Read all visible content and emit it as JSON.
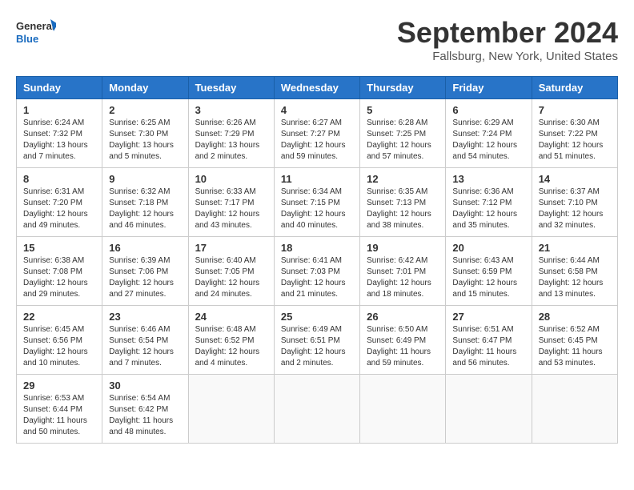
{
  "logo": {
    "line1": "General",
    "line2": "Blue"
  },
  "title": "September 2024",
  "location": "Fallsburg, New York, United States",
  "weekdays": [
    "Sunday",
    "Monday",
    "Tuesday",
    "Wednesday",
    "Thursday",
    "Friday",
    "Saturday"
  ],
  "weeks": [
    [
      {
        "day": "1",
        "sunrise": "6:24 AM",
        "sunset": "7:32 PM",
        "daylight": "13 hours and 7 minutes."
      },
      {
        "day": "2",
        "sunrise": "6:25 AM",
        "sunset": "7:30 PM",
        "daylight": "13 hours and 5 minutes."
      },
      {
        "day": "3",
        "sunrise": "6:26 AM",
        "sunset": "7:29 PM",
        "daylight": "13 hours and 2 minutes."
      },
      {
        "day": "4",
        "sunrise": "6:27 AM",
        "sunset": "7:27 PM",
        "daylight": "12 hours and 59 minutes."
      },
      {
        "day": "5",
        "sunrise": "6:28 AM",
        "sunset": "7:25 PM",
        "daylight": "12 hours and 57 minutes."
      },
      {
        "day": "6",
        "sunrise": "6:29 AM",
        "sunset": "7:24 PM",
        "daylight": "12 hours and 54 minutes."
      },
      {
        "day": "7",
        "sunrise": "6:30 AM",
        "sunset": "7:22 PM",
        "daylight": "12 hours and 51 minutes."
      }
    ],
    [
      {
        "day": "8",
        "sunrise": "6:31 AM",
        "sunset": "7:20 PM",
        "daylight": "12 hours and 49 minutes."
      },
      {
        "day": "9",
        "sunrise": "6:32 AM",
        "sunset": "7:18 PM",
        "daylight": "12 hours and 46 minutes."
      },
      {
        "day": "10",
        "sunrise": "6:33 AM",
        "sunset": "7:17 PM",
        "daylight": "12 hours and 43 minutes."
      },
      {
        "day": "11",
        "sunrise": "6:34 AM",
        "sunset": "7:15 PM",
        "daylight": "12 hours and 40 minutes."
      },
      {
        "day": "12",
        "sunrise": "6:35 AM",
        "sunset": "7:13 PM",
        "daylight": "12 hours and 38 minutes."
      },
      {
        "day": "13",
        "sunrise": "6:36 AM",
        "sunset": "7:12 PM",
        "daylight": "12 hours and 35 minutes."
      },
      {
        "day": "14",
        "sunrise": "6:37 AM",
        "sunset": "7:10 PM",
        "daylight": "12 hours and 32 minutes."
      }
    ],
    [
      {
        "day": "15",
        "sunrise": "6:38 AM",
        "sunset": "7:08 PM",
        "daylight": "12 hours and 29 minutes."
      },
      {
        "day": "16",
        "sunrise": "6:39 AM",
        "sunset": "7:06 PM",
        "daylight": "12 hours and 27 minutes."
      },
      {
        "day": "17",
        "sunrise": "6:40 AM",
        "sunset": "7:05 PM",
        "daylight": "12 hours and 24 minutes."
      },
      {
        "day": "18",
        "sunrise": "6:41 AM",
        "sunset": "7:03 PM",
        "daylight": "12 hours and 21 minutes."
      },
      {
        "day": "19",
        "sunrise": "6:42 AM",
        "sunset": "7:01 PM",
        "daylight": "12 hours and 18 minutes."
      },
      {
        "day": "20",
        "sunrise": "6:43 AM",
        "sunset": "6:59 PM",
        "daylight": "12 hours and 15 minutes."
      },
      {
        "day": "21",
        "sunrise": "6:44 AM",
        "sunset": "6:58 PM",
        "daylight": "12 hours and 13 minutes."
      }
    ],
    [
      {
        "day": "22",
        "sunrise": "6:45 AM",
        "sunset": "6:56 PM",
        "daylight": "12 hours and 10 minutes."
      },
      {
        "day": "23",
        "sunrise": "6:46 AM",
        "sunset": "6:54 PM",
        "daylight": "12 hours and 7 minutes."
      },
      {
        "day": "24",
        "sunrise": "6:48 AM",
        "sunset": "6:52 PM",
        "daylight": "12 hours and 4 minutes."
      },
      {
        "day": "25",
        "sunrise": "6:49 AM",
        "sunset": "6:51 PM",
        "daylight": "12 hours and 2 minutes."
      },
      {
        "day": "26",
        "sunrise": "6:50 AM",
        "sunset": "6:49 PM",
        "daylight": "11 hours and 59 minutes."
      },
      {
        "day": "27",
        "sunrise": "6:51 AM",
        "sunset": "6:47 PM",
        "daylight": "11 hours and 56 minutes."
      },
      {
        "day": "28",
        "sunrise": "6:52 AM",
        "sunset": "6:45 PM",
        "daylight": "11 hours and 53 minutes."
      }
    ],
    [
      {
        "day": "29",
        "sunrise": "6:53 AM",
        "sunset": "6:44 PM",
        "daylight": "11 hours and 50 minutes."
      },
      {
        "day": "30",
        "sunrise": "6:54 AM",
        "sunset": "6:42 PM",
        "daylight": "11 hours and 48 minutes."
      },
      null,
      null,
      null,
      null,
      null
    ]
  ]
}
